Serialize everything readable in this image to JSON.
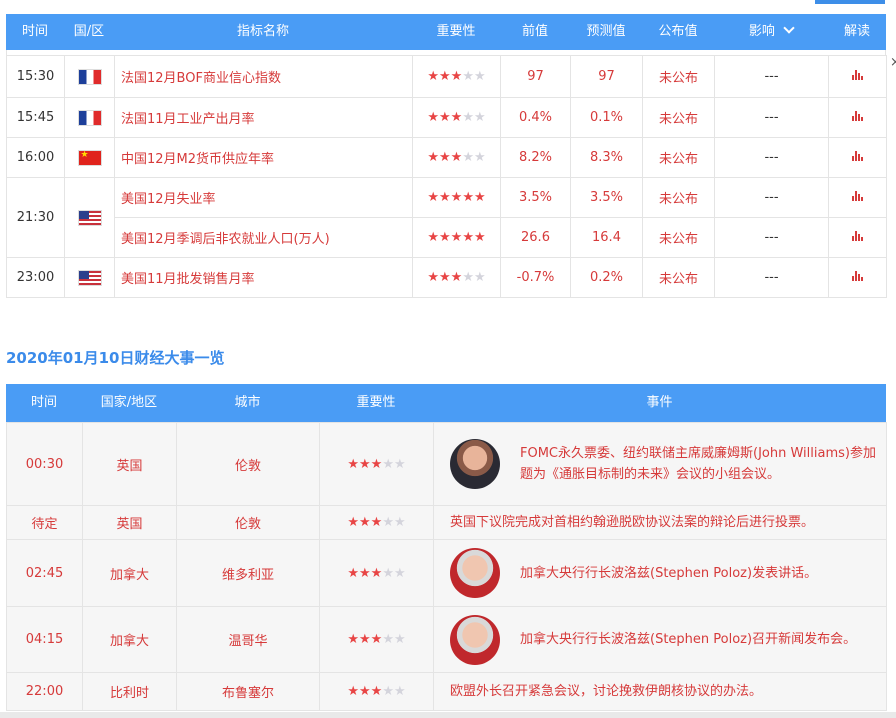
{
  "top": {
    "fragment": "财经日历"
  },
  "table1": {
    "headers": [
      "时间",
      "国/区",
      "指标名称",
      "重要性",
      "前值",
      "预测值",
      "公布值",
      "影响",
      "解读"
    ],
    "rows": [
      {
        "time": "15:30",
        "country": "fr",
        "name": "法国12月BOF商业信心指数",
        "stars": 3,
        "prev": "97",
        "forecast": "97",
        "actual": "未公布",
        "impact": "---"
      },
      {
        "time": "15:45",
        "country": "fr",
        "name": "法国11月工业产出月率",
        "stars": 3,
        "prev": "0.4%",
        "forecast": "0.1%",
        "actual": "未公布",
        "impact": "---"
      },
      {
        "time": "16:00",
        "country": "cn",
        "name": "中国12月M2货币供应年率",
        "stars": 3,
        "prev": "8.2%",
        "forecast": "8.3%",
        "actual": "未公布",
        "impact": "---"
      },
      {
        "time": "21:30",
        "country": "us",
        "name": "美国12月失业率",
        "stars": 5,
        "prev": "3.5%",
        "forecast": "3.5%",
        "actual": "未公布",
        "impact": "---"
      },
      {
        "time": "",
        "country": "",
        "name": "美国12月季调后非农就业人口(万人)",
        "stars": 5,
        "prev": "26.6",
        "forecast": "16.4",
        "actual": "未公布",
        "impact": "---"
      },
      {
        "time": "23:00",
        "country": "us",
        "name": "美国11月批发销售月率",
        "stars": 3,
        "prev": "-0.7%",
        "forecast": "0.2%",
        "actual": "未公布",
        "impact": "---"
      }
    ]
  },
  "section2": {
    "title": "2020年01月10日财经大事一览",
    "headers": [
      "时间",
      "国家/地区",
      "城市",
      "重要性",
      "事件"
    ],
    "rows": [
      {
        "time": "00:30",
        "country": "英国",
        "city": "伦敦",
        "stars": 3,
        "avatar": "jw",
        "event": "FOMC永久票委、纽约联储主席威廉姆斯(John Williams)参加题为《通胀目标制的未来》会议的小组会议。"
      },
      {
        "time": "待定",
        "country": "英国",
        "city": "伦敦",
        "stars": 3,
        "avatar": "",
        "event": "英国下议院完成对首相约翰逊脱欧协议法案的辩论后进行投票。"
      },
      {
        "time": "02:45",
        "country": "加拿大",
        "city": "维多利亚",
        "stars": 3,
        "avatar": "sp",
        "event": "加拿大央行行长波洛兹(Stephen Poloz)发表讲话。"
      },
      {
        "time": "04:15",
        "country": "加拿大",
        "city": "温哥华",
        "stars": 3,
        "avatar": "sp",
        "event": "加拿大央行行长波洛兹(Stephen Poloz)召开新闻发布会。"
      },
      {
        "time": "22:00",
        "country": "比利时",
        "city": "布鲁塞尔",
        "stars": 3,
        "avatar": "",
        "event": "欧盟外长召开紧急会议，讨论挽救伊朗核协议的办法。"
      }
    ]
  },
  "colors": {
    "header_bg": "#4a9cf5",
    "accent_red": "#d63a3a",
    "title_blue": "#3b8bea"
  }
}
